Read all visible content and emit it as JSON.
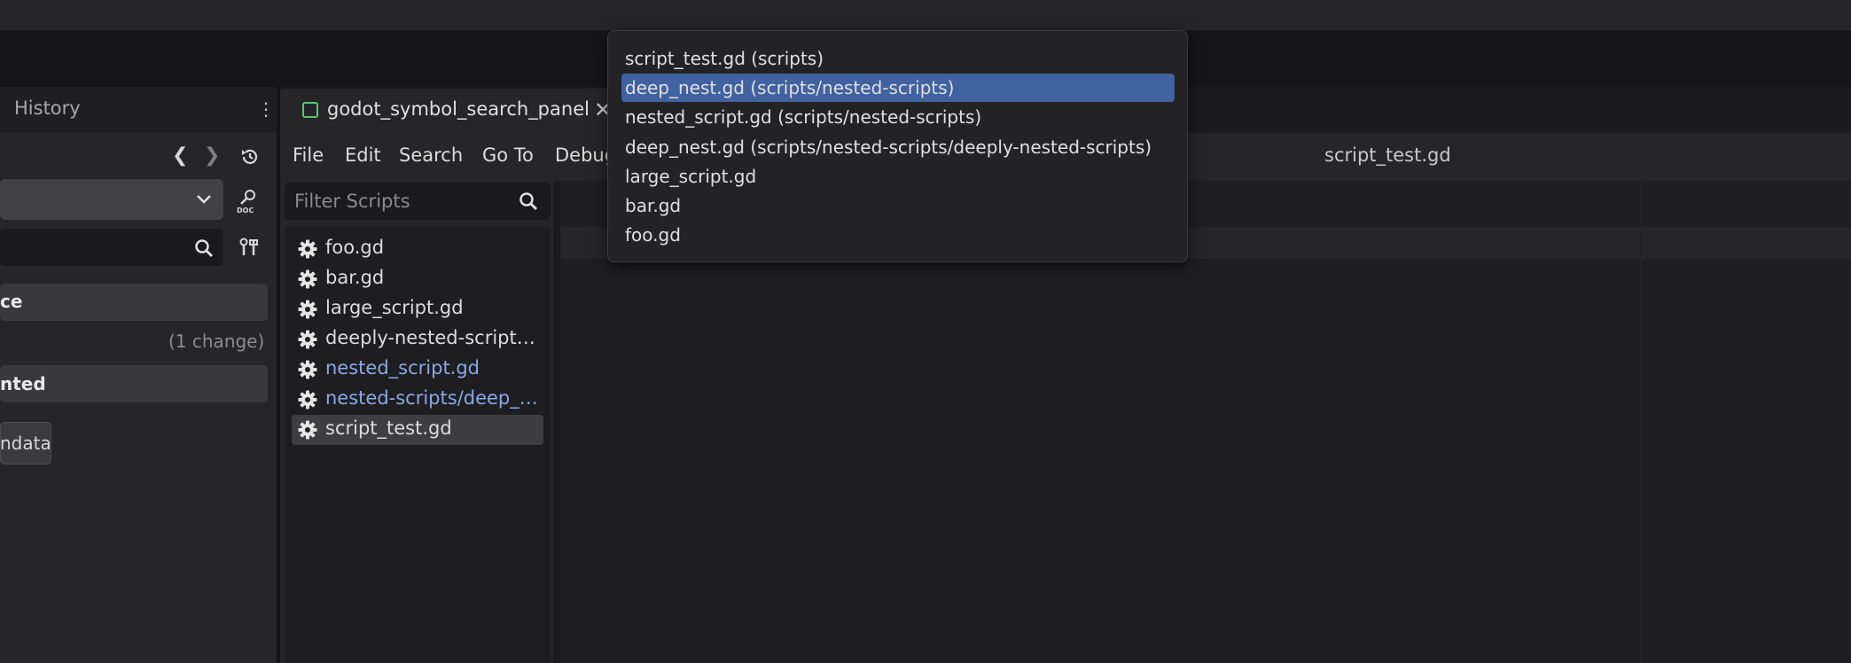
{
  "left_dock": {
    "history_tab": "History",
    "section1_label": "ce",
    "change_count": "(1 change)",
    "section2_label": "nted",
    "metadata_button": "ndata"
  },
  "editor": {
    "tab_label": "godot_symbol_search_panel",
    "menu": [
      "File",
      "Edit",
      "Search",
      "Go To",
      "Debug"
    ],
    "current_file": "script_test.gd",
    "filter_placeholder": "Filter Scripts",
    "scripts": [
      {
        "name": "foo.gd",
        "highlight": false,
        "selected": false
      },
      {
        "name": "bar.gd",
        "highlight": false,
        "selected": false
      },
      {
        "name": "large_script.gd",
        "highlight": false,
        "selected": false
      },
      {
        "name": "deeply-nested-script…",
        "highlight": false,
        "selected": false
      },
      {
        "name": "nested_script.gd",
        "highlight": true,
        "selected": false
      },
      {
        "name": "nested-scripts/deep_…",
        "highlight": true,
        "selected": false
      },
      {
        "name": "script_test.gd",
        "highlight": false,
        "selected": true
      }
    ]
  },
  "popup": {
    "items": [
      "script_test.gd (scripts)",
      "deep_nest.gd (scripts/nested-scripts)",
      "nested_script.gd (scripts/nested-scripts)",
      "deep_nest.gd (scripts/nested-scripts/deeply-nested-scripts)",
      "large_script.gd",
      "bar.gd",
      "foo.gd"
    ],
    "selected_index": 1
  },
  "icons": {
    "tab_icon": "script-scene-icon",
    "gear": "gear-icon",
    "search": "search-icon"
  },
  "colors": {
    "accent_selection": "#3f62a0",
    "highlight_text": "#88a9e6",
    "tab_icon_green": "#59c76d"
  }
}
